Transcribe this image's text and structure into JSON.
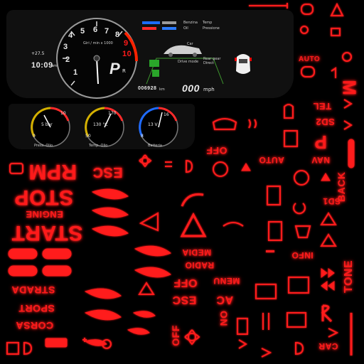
{
  "cluster": {
    "tach_numbers": [
      "1",
      "2",
      "3",
      "4",
      "5",
      "6",
      "7",
      "8",
      "9",
      "10"
    ],
    "tach_unit": "Giri / min x 1000",
    "gear": "P",
    "gear_suffix": "R",
    "temp_outside": "+27.5",
    "clock": "10:09",
    "clock_suffix": "am",
    "odometer": "006928",
    "odometer_unit": "km",
    "speed": "000",
    "speed_unit": "mph",
    "mode_label_1": "Car",
    "mode_label_2": "Drive mode",
    "mode_label_3": "Rear gear",
    "mode_label_4": "Direct",
    "status_labels": [
      "Benzina",
      "Oil",
      "Temp",
      "Pressione"
    ]
  },
  "gauges": [
    {
      "label": "Press. Olio",
      "min": "0",
      "max": "10",
      "value_text": "5 bar"
    },
    {
      "label": "Temp. Olio",
      "min": "50",
      "max": "170",
      "value_text": "130 °C"
    },
    {
      "label": "Batteria",
      "min": "8",
      "max": "16",
      "value_text": "13 V"
    }
  ],
  "words": {
    "rpm": "RPM",
    "esc": "ESC",
    "stop": "STOP",
    "engine": "ENGINE",
    "start": "START",
    "strada": "STRADA",
    "sport": "SPORT",
    "corsa": "CORSA",
    "off": "OFF",
    "auto": "AUTO",
    "nav": "NAV",
    "sd2": "SD2",
    "tel": "TEL",
    "sd1": "SD1",
    "back": "BACK",
    "radio": "RADIO",
    "media": "MEDIA",
    "info": "INFO",
    "menu": "MENU",
    "ac": "AC",
    "tone": "TONE",
    "on": "ON",
    "car": "CAR",
    "m": "M",
    "p": "P"
  }
}
